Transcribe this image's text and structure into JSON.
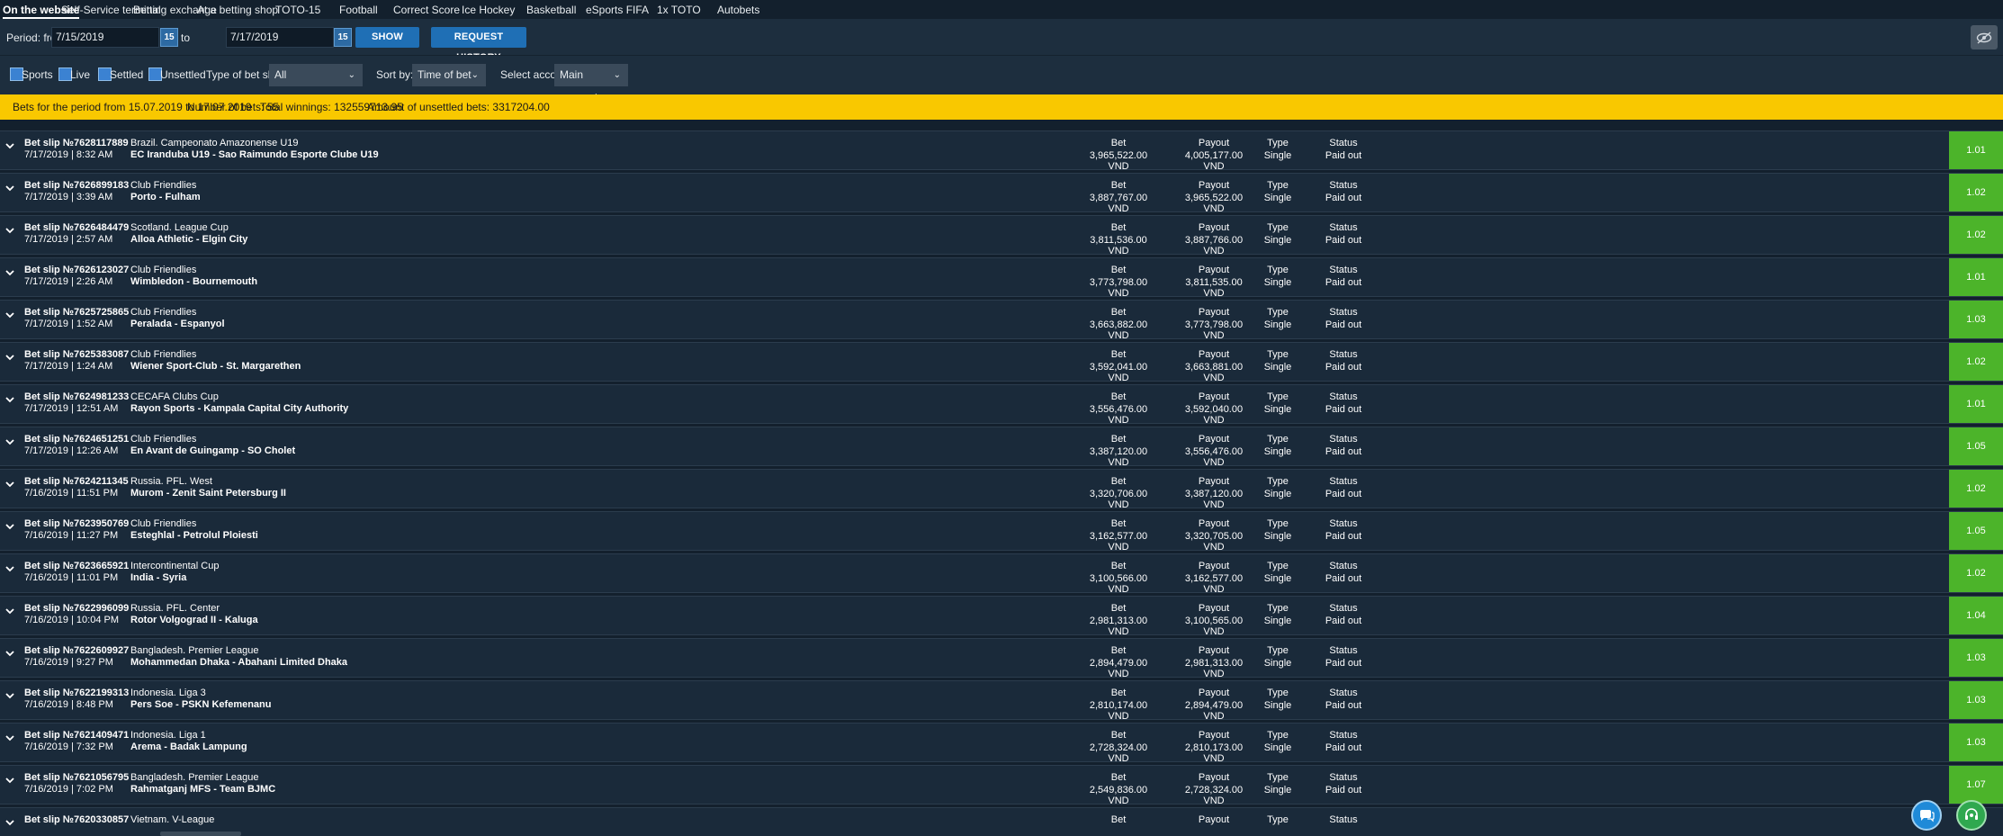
{
  "tabs": [
    {
      "label": "On the website",
      "active": true
    },
    {
      "label": "Self-Service terminal"
    },
    {
      "label": "Betting exchange"
    },
    {
      "label": "At a betting shop"
    },
    {
      "label": "TOTO-15"
    },
    {
      "label": "Football"
    },
    {
      "label": "Correct Score"
    },
    {
      "label": "Ice Hockey"
    },
    {
      "label": "Basketball"
    },
    {
      "label": "eSports FIFA"
    },
    {
      "label": "1x TOTO"
    },
    {
      "label": "Autobets"
    }
  ],
  "period": {
    "from_label": "Period: from",
    "from_value": "7/15/2019",
    "to_label": "to",
    "to_value": "7/17/2019",
    "calendar_glyph": "15",
    "show_label": "SHOW",
    "request_label": "REQUEST HISTORY"
  },
  "filters": {
    "sports": "Sports",
    "live": "Live",
    "settled": "Settled",
    "unsettled": "Unsettled",
    "type_label": "Type of bet slip:",
    "type_value": "All",
    "sort_label": "Sort by:",
    "sort_value": "Time of bet",
    "account_label": "Select account:",
    "account_value": "Main account"
  },
  "summary": {
    "period": "Bets for the period from 15.07.2019 to 17.07.2019",
    "count": "Number of bets: 55",
    "winnings": "Total winnings: 132559713.95",
    "unsettled": "Amount of unsettled bets: 3317204.00"
  },
  "columns": {
    "bet": "Bet",
    "payout": "Payout",
    "type": "Type",
    "status": "Status"
  },
  "bets": [
    {
      "slip": "Bet slip №7628117889",
      "date": "7/17/2019 | 8:32 AM",
      "league": "Brazil. Campeonato Amazonense U19",
      "match": "EC Iranduba U19 - Sao Raimundo Esporte Clube U19",
      "bet": "3,965,522.00 VND",
      "payout": "4,005,177.00 VND",
      "type": "Single",
      "status": "Paid out",
      "odds": "1.01"
    },
    {
      "slip": "Bet slip №7626899183",
      "date": "7/17/2019 | 3:39 AM",
      "league": "Club Friendlies",
      "match": "Porto - Fulham",
      "bet": "3,887,767.00 VND",
      "payout": "3,965,522.00 VND",
      "type": "Single",
      "status": "Paid out",
      "odds": "1.02"
    },
    {
      "slip": "Bet slip №7626484479",
      "date": "7/17/2019 | 2:57 AM",
      "league": "Scotland. League Cup",
      "match": "Alloa Athletic - Elgin City",
      "bet": "3,811,536.00 VND",
      "payout": "3,887,766.00 VND",
      "type": "Single",
      "status": "Paid out",
      "odds": "1.02"
    },
    {
      "slip": "Bet slip №7626123027",
      "date": "7/17/2019 | 2:26 AM",
      "league": "Club Friendlies",
      "match": "Wimbledon - Bournemouth",
      "bet": "3,773,798.00 VND",
      "payout": "3,811,535.00 VND",
      "type": "Single",
      "status": "Paid out",
      "odds": "1.01"
    },
    {
      "slip": "Bet slip №7625725865",
      "date": "7/17/2019 | 1:52 AM",
      "league": "Club Friendlies",
      "match": "Peralada - Espanyol",
      "bet": "3,663,882.00 VND",
      "payout": "3,773,798.00 VND",
      "type": "Single",
      "status": "Paid out",
      "odds": "1.03"
    },
    {
      "slip": "Bet slip №7625383087",
      "date": "7/17/2019 | 1:24 AM",
      "league": "Club Friendlies",
      "match": "Wiener Sport-Club - St. Margarethen",
      "bet": "3,592,041.00 VND",
      "payout": "3,663,881.00 VND",
      "type": "Single",
      "status": "Paid out",
      "odds": "1.02"
    },
    {
      "slip": "Bet slip №7624981233",
      "date": "7/17/2019 | 12:51 AM",
      "league": "CECAFA Clubs Cup",
      "match": "Rayon Sports - Kampala Capital City Authority",
      "bet": "3,556,476.00 VND",
      "payout": "3,592,040.00 VND",
      "type": "Single",
      "status": "Paid out",
      "odds": "1.01"
    },
    {
      "slip": "Bet slip №7624651251",
      "date": "7/17/2019 | 12:26 AM",
      "league": "Club Friendlies",
      "match": "En Avant de Guingamp - SO Cholet",
      "bet": "3,387,120.00 VND",
      "payout": "3,556,476.00 VND",
      "type": "Single",
      "status": "Paid out",
      "odds": "1.05"
    },
    {
      "slip": "Bet slip №7624211345",
      "date": "7/16/2019 | 11:51 PM",
      "league": "Russia. PFL. West",
      "match": "Murom - Zenit Saint Petersburg II",
      "bet": "3,320,706.00 VND",
      "payout": "3,387,120.00 VND",
      "type": "Single",
      "status": "Paid out",
      "odds": "1.02"
    },
    {
      "slip": "Bet slip №7623950769",
      "date": "7/16/2019 | 11:27 PM",
      "league": "Club Friendlies",
      "match": "Esteghlal - Petrolul Ploiesti",
      "bet": "3,162,577.00 VND",
      "payout": "3,320,705.00 VND",
      "type": "Single",
      "status": "Paid out",
      "odds": "1.05"
    },
    {
      "slip": "Bet slip №7623665921",
      "date": "7/16/2019 | 11:01 PM",
      "league": "Intercontinental Cup",
      "match": "India - Syria",
      "bet": "3,100,566.00 VND",
      "payout": "3,162,577.00 VND",
      "type": "Single",
      "status": "Paid out",
      "odds": "1.02"
    },
    {
      "slip": "Bet slip №7622996099",
      "date": "7/16/2019 | 10:04 PM",
      "league": "Russia. PFL. Center",
      "match": "Rotor Volgograd II - Kaluga",
      "bet": "2,981,313.00 VND",
      "payout": "3,100,565.00 VND",
      "type": "Single",
      "status": "Paid out",
      "odds": "1.04"
    },
    {
      "slip": "Bet slip №7622609927",
      "date": "7/16/2019 | 9:27 PM",
      "league": "Bangladesh. Premier League",
      "match": "Mohammedan Dhaka - Abahani Limited Dhaka",
      "bet": "2,894,479.00 VND",
      "payout": "2,981,313.00 VND",
      "type": "Single",
      "status": "Paid out",
      "odds": "1.03"
    },
    {
      "slip": "Bet slip №7622199313",
      "date": "7/16/2019 | 8:48 PM",
      "league": "Indonesia. Liga 3",
      "match": "Pers Soe - PSKN Kefemenanu",
      "bet": "2,810,174.00 VND",
      "payout": "2,894,479.00 VND",
      "type": "Single",
      "status": "Paid out",
      "odds": "1.03"
    },
    {
      "slip": "Bet slip №7621409471",
      "date": "7/16/2019 | 7:32 PM",
      "league": "Indonesia. Liga 1",
      "match": "Arema - Badak Lampung",
      "bet": "2,728,324.00 VND",
      "payout": "2,810,173.00 VND",
      "type": "Single",
      "status": "Paid out",
      "odds": "1.03"
    },
    {
      "slip": "Bet slip №7621056795",
      "date": "7/16/2019 | 7:02 PM",
      "league": "Bangladesh. Premier League",
      "match": "Rahmatganj MFS - Team BJMC",
      "bet": "2,549,836.00 VND",
      "payout": "2,728,324.00 VND",
      "type": "Single",
      "status": "Paid out",
      "odds": "1.07"
    },
    {
      "slip": "Bet slip №7620330857",
      "date": "",
      "league": "Vietnam. V-League",
      "match": "",
      "bet": "",
      "payout": "",
      "type": "Type",
      "status": "Status",
      "odds": ""
    }
  ],
  "colors": {
    "odds_green": "#4cb42a",
    "summary_yellow": "#f9c800",
    "button_blue": "#1f6fb5"
  },
  "icons": {
    "eye": "eye-off-icon",
    "chat": "chat-icon",
    "support": "headset-icon",
    "row": "chevron-down-icon",
    "calendar": "calendar-icon"
  }
}
